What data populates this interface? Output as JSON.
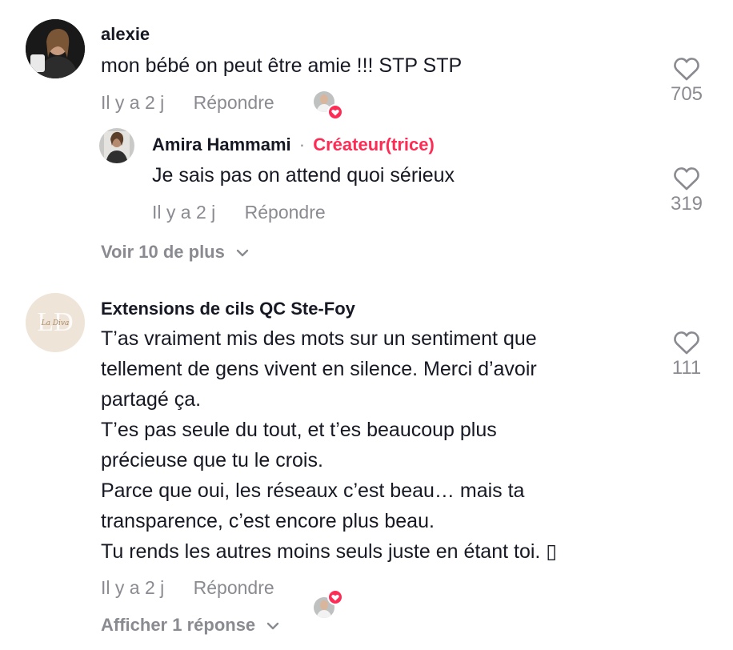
{
  "comments": [
    {
      "username": "alexie",
      "text": "mon bébé on peut être amie !!! STP STP",
      "time": "Il y a 2 j",
      "reply_label": "Répondre",
      "likes": "705",
      "creator_liked": true,
      "replies": [
        {
          "username": "Amira Hammami",
          "separator": "·",
          "badge": "Créateur(trice)",
          "text": "Je sais pas on attend quoi sérieux",
          "time": "Il y a 2 j",
          "reply_label": "Répondre",
          "likes": "319"
        }
      ],
      "more_label": "Voir 10 de plus"
    },
    {
      "username": "Extensions de cils QC Ste-Foy",
      "avatar_logo_text": "La Diva",
      "avatar_monogram": "LD",
      "text_lines": [
        "T’as vraiment mis des mots sur un sentiment que",
        "tellement de gens vivent en silence. Merci d’avoir",
        "partagé ça.",
        "T’es pas seule du tout, et t’es beaucoup plus",
        "précieuse que tu le crois.",
        "Parce que oui, les réseaux c’est beau… mais ta",
        "transparence, c’est encore plus beau.",
        "Tu rends les autres moins seuls juste en étant toi. ▯"
      ],
      "time": "Il y a 2 j",
      "reply_label": "Répondre",
      "likes": "111",
      "creator_liked": true,
      "more_label": "Afficher 1 réponse"
    }
  ],
  "colors": {
    "text": "#161823",
    "secondary": "#8a8b91",
    "accent": "#fe2c55"
  }
}
